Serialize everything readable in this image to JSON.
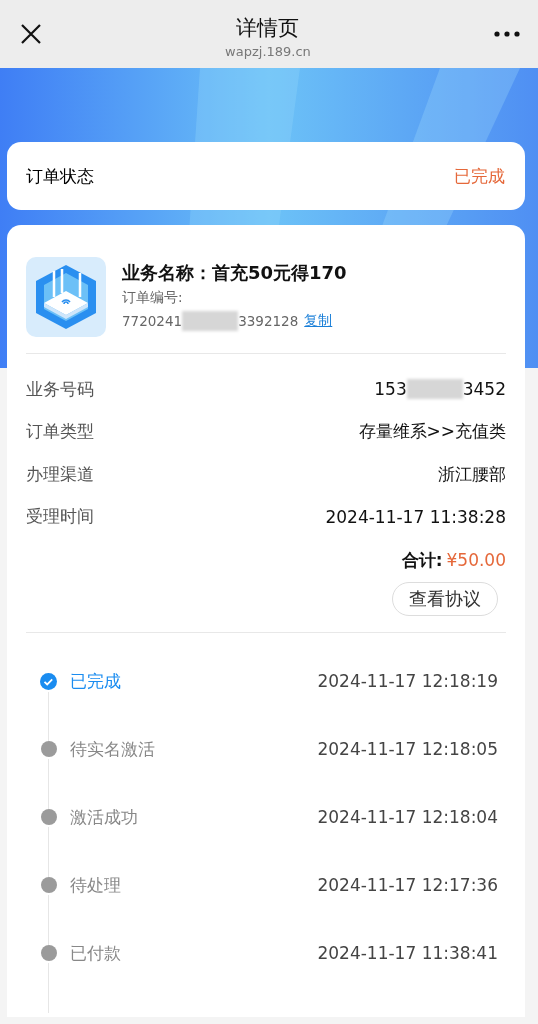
{
  "nav": {
    "title": "详情页",
    "subtitle": "wapzj.189.cn"
  },
  "status": {
    "label": "订单状态",
    "value": "已完成"
  },
  "order": {
    "name": "业务名称：首充50元得170",
    "number_label": "订单编号:",
    "number_start": "7720241",
    "number_end": "3392128",
    "copy": "复制",
    "fields": [
      {
        "label": "业务号码",
        "value_start": "153",
        "value_end": "3452",
        "masked": true
      },
      {
        "label": "订单类型",
        "value_start": "存量维系>>充值类",
        "masked": false
      },
      {
        "label": "办理渠道",
        "value_start": "浙江腰部",
        "masked": false
      },
      {
        "label": "受理时间",
        "value_start": "2024-11-17 11:38:28",
        "masked": false
      }
    ],
    "total_label": "合计:",
    "total": "¥50.00",
    "agreement": "查看协议"
  },
  "timeline": [
    {
      "label": "已完成",
      "time": "2024-11-17 12:18:19",
      "current": true
    },
    {
      "label": "待实名激活",
      "time": "2024-11-17 12:18:05",
      "current": false
    },
    {
      "label": "激活成功",
      "time": "2024-11-17 12:18:04",
      "current": false
    },
    {
      "label": "待处理",
      "time": "2024-11-17 12:17:36",
      "current": false
    },
    {
      "label": "已付款",
      "time": "2024-11-17 11:38:41",
      "current": false
    }
  ]
}
